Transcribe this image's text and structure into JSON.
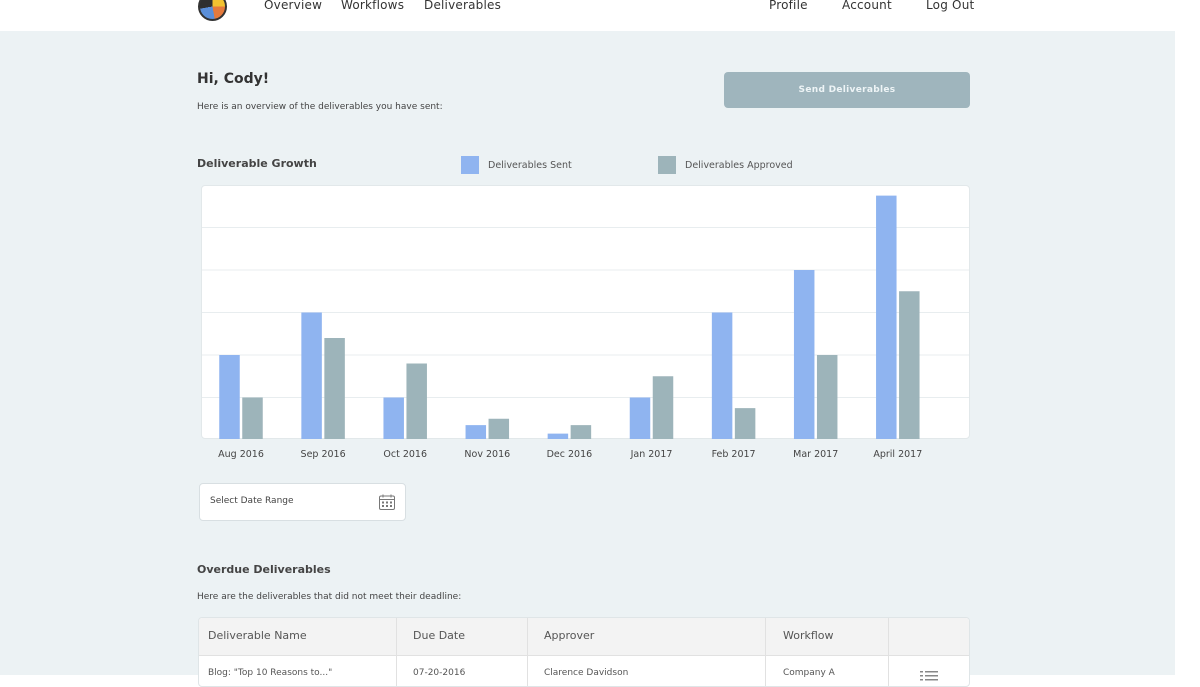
{
  "nav": {
    "logo_icon": "rainbow-circle-logo",
    "left": [
      "Overview",
      "Workflows",
      "Deliverables"
    ],
    "right": [
      "Profile",
      "Account",
      "Log Out"
    ]
  },
  "header": {
    "greeting": "Hi, Cody!",
    "subtitle": "Here is an overview of the deliverables you have sent:",
    "send_button": "Send Deliverables"
  },
  "growth": {
    "title": "Deliverable Growth",
    "legend": [
      {
        "label": "Deliverables Sent",
        "color": "#8fb4f0"
      },
      {
        "label": "Deliverables Approved",
        "color": "#9db4ba"
      }
    ]
  },
  "chart_data": {
    "type": "bar",
    "categories": [
      "Aug 2016",
      "Sep 2016",
      "Oct 2016",
      "Nov 2016",
      "Dec 2016",
      "Jan 2017",
      "Feb 2017",
      "Mar 2017",
      "April 2017"
    ],
    "series": [
      {
        "name": "Deliverables Sent",
        "color": "#8fb4f0",
        "values": [
          2,
          3,
          1,
          0.35,
          0.15,
          1,
          3,
          4,
          5.75
        ]
      },
      {
        "name": "Deliverables Approved",
        "color": "#9db4ba",
        "values": [
          1,
          2.4,
          1.8,
          0.5,
          0.35,
          1.5,
          0.75,
          2,
          3.5
        ]
      }
    ],
    "ylim": [
      0,
      6
    ],
    "grid": true
  },
  "date_range": {
    "placeholder": "Select Date Range",
    "icon": "calendar-icon"
  },
  "overdue": {
    "title": "Overdue Deliverables",
    "subtitle": "Here are the deliverables that did not meet their deadline:",
    "columns": [
      "Deliverable Name",
      "Due Date",
      "Approver",
      "Workflow"
    ],
    "rows": [
      {
        "name": "Blog: \"Top 10 Reasons to...\"",
        "due": "07-20-2016",
        "approver": "Clarence Davidson",
        "workflow": "Company A",
        "menu_icon": "list-menu-icon"
      }
    ]
  }
}
